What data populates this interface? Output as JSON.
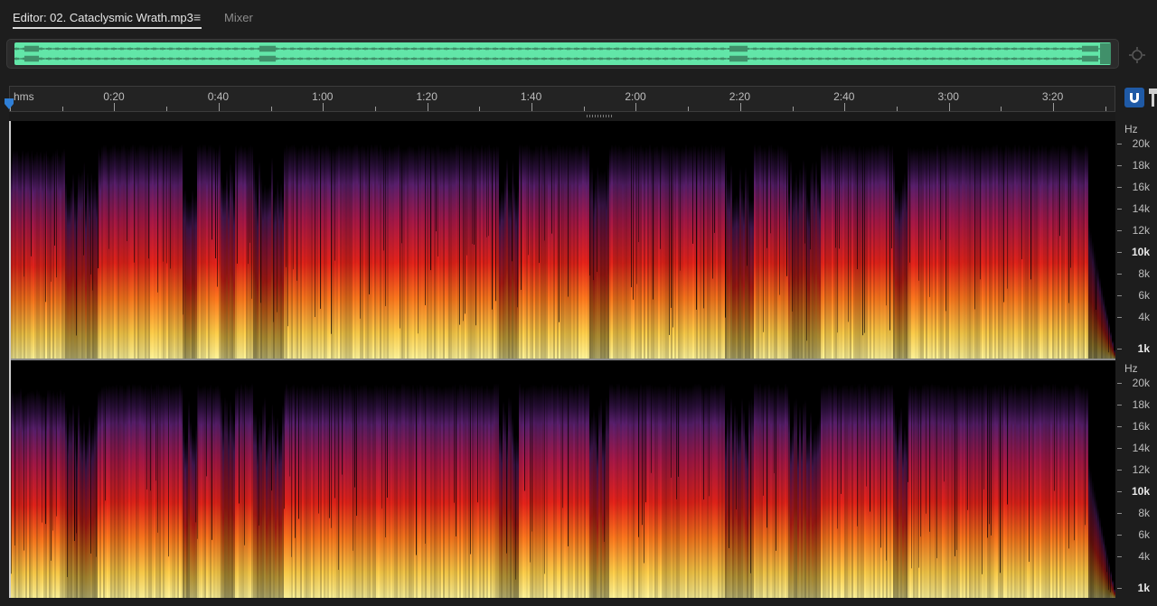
{
  "tabs": {
    "editor_label": "Editor: 02. Cataclysmic Wrath.mp3",
    "menu_glyph": "≡",
    "mixer_label": "Mixer"
  },
  "ruler": {
    "unit": "hms",
    "labels": [
      "0:20",
      "0:40",
      "1:00",
      "1:20",
      "1:40",
      "2:00",
      "2:20",
      "2:40",
      "3:00",
      "3:20"
    ]
  },
  "frequency_scale": {
    "unit": "Hz",
    "labels": [
      "20k",
      "18k",
      "16k",
      "14k",
      "12k",
      "10k",
      "8k",
      "6k",
      "4k",
      "1k"
    ],
    "major": [
      "10k",
      "1k"
    ]
  },
  "icons": {
    "menu": "hamburger-menu-icon",
    "zoom_nav": "zoom-navigator-icon",
    "snap": "magnet-snap-icon",
    "marker": "marker-pin-icon",
    "playhead": "playhead-marker-icon"
  },
  "colors": {
    "overview_waveform": "#62e6a8",
    "snap_active": "#1f5aa6",
    "spectrum_low": "#fff27a",
    "spectrum_mid": "#e8231a",
    "spectrum_high": "#5a1f6e"
  }
}
